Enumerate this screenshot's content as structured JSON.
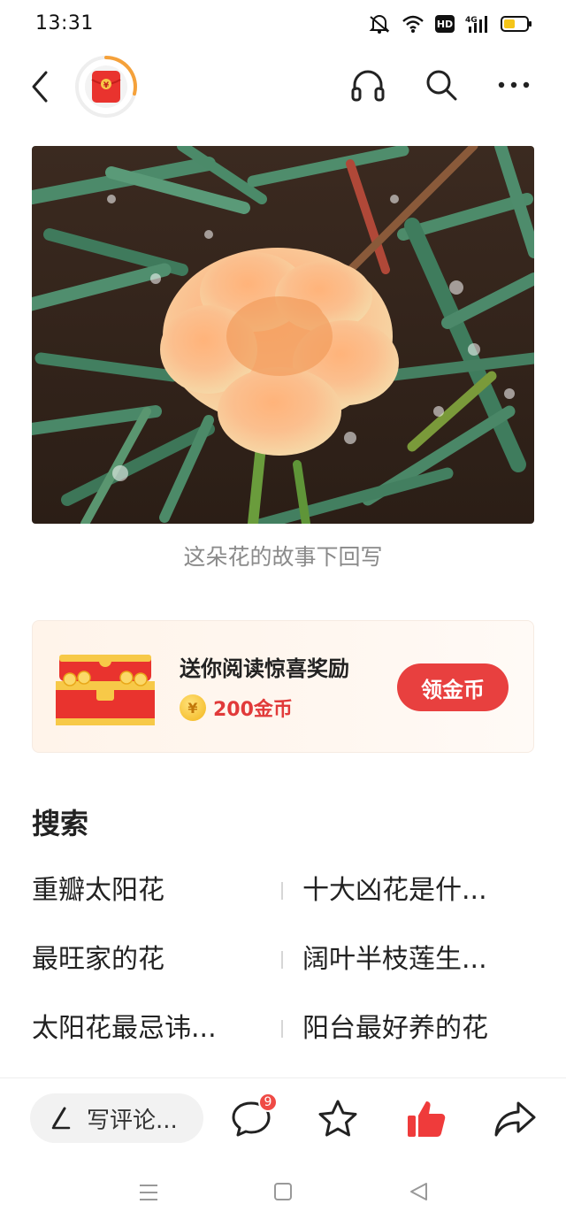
{
  "status_bar": {
    "time": "13:31",
    "network_label": "4G",
    "hd_label": "HD"
  },
  "nav": {
    "back_icon": "chevron-left-icon",
    "redpacket_icon": "red-envelope-icon",
    "redpacket_symbol": "¥",
    "listen_icon": "headphones-icon",
    "search_icon": "search-icon",
    "more_icon": "more-dots-icon",
    "accent_color": "#f5a13a"
  },
  "article": {
    "image_subject": "flower-photo",
    "caption": "这朵花的故事下回写"
  },
  "reward": {
    "title": "送你阅读惊喜奖励",
    "coin_symbol": "¥",
    "amount": "200金币",
    "button_label": "领金币",
    "button_color": "#e8403f"
  },
  "search": {
    "heading": "搜索",
    "items": [
      [
        "重瓣太阳花",
        "十大凶花是什..."
      ],
      [
        "最旺家的花",
        "阔叶半枝莲生..."
      ],
      [
        "太阳花最忌讳...",
        "阳台最好养的花"
      ]
    ]
  },
  "action_bar": {
    "comment_placeholder": "写评论...",
    "comment_badge": "9",
    "like_color": "#ef3b3b"
  }
}
